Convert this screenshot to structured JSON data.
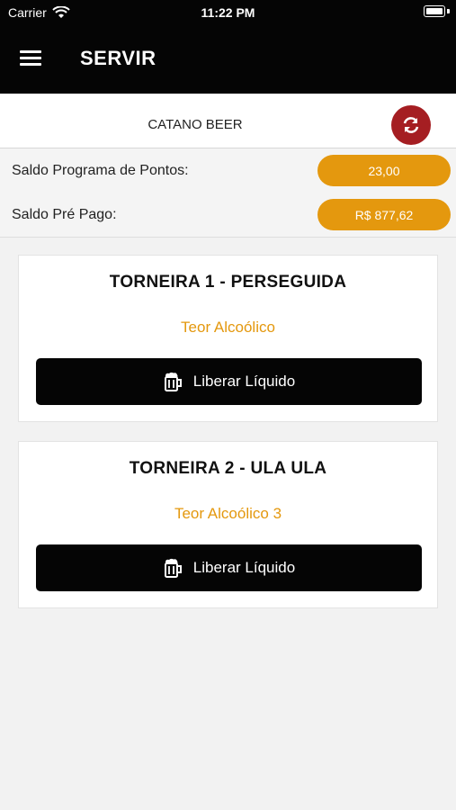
{
  "status_bar": {
    "carrier": "Carrier",
    "time": "11:22 PM"
  },
  "header": {
    "title": "SERVIR",
    "menu_icon": "hamburger-menu-icon"
  },
  "store": {
    "name": "CATANO BEER",
    "refresh_icon": "refresh-icon",
    "refresh_color": "#a51e22"
  },
  "balances": [
    {
      "label": "Saldo Programa de Pontos:",
      "value": "23,00"
    },
    {
      "label": "Saldo Pré Pago:",
      "value": "R$ 877,62"
    }
  ],
  "taps": [
    {
      "title": "TORNEIRA 1 - PERSEGUIDA",
      "subtitle": "Teor Alcoólico",
      "button_label": "Liberar Líquido",
      "button_icon": "beer-mug-icon"
    },
    {
      "title": "TORNEIRA 2 - ULA ULA",
      "subtitle": "Teor Alcoólico 3",
      "button_label": "Liberar Líquido",
      "button_icon": "beer-mug-icon"
    }
  ],
  "colors": {
    "accent": "#e4980e",
    "header_bg": "#050505",
    "button_bg": "#050505"
  }
}
